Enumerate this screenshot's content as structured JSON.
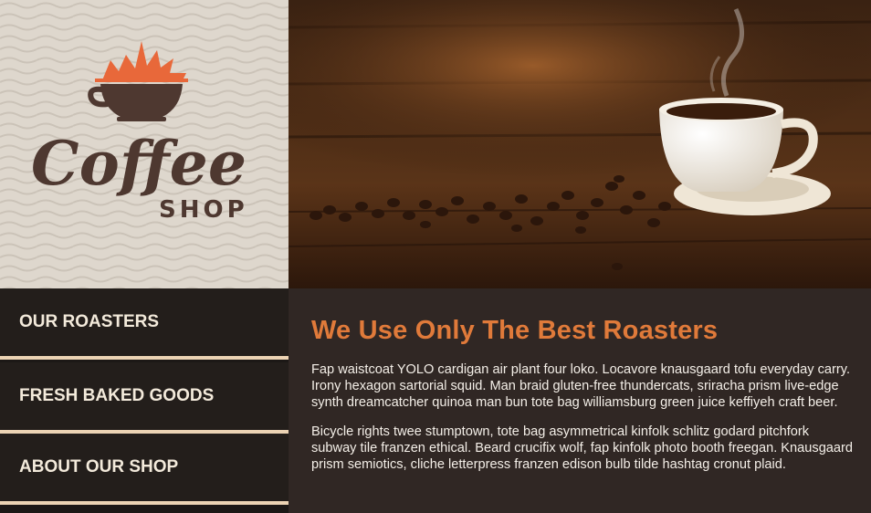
{
  "logo": {
    "script_text": "Coffee",
    "sub_text": "SHOP"
  },
  "nav": {
    "items": [
      {
        "label": "OUR ROASTERS"
      },
      {
        "label": "FRESH BAKED GOODS"
      },
      {
        "label": "ABOUT OUR SHOP"
      }
    ]
  },
  "main": {
    "heading": "We Use Only The Best Roasters",
    "paragraphs": [
      "Fap waistcoat YOLO cardigan air plant four loko. Locavore knausgaard tofu everyday carry. Irony hexagon sartorial squid. Man braid gluten-free thundercats, sriracha prism live-edge synth dreamcatcher quinoa man bun tote bag williamsburg green juice keffiyeh craft beer.",
      "Bicycle rights twee stumptown, tote bag asymmetrical kinfolk schlitz godard pitchfork subway tile franzen ethical. Beard crucifix wolf, fap kinfolk photo booth freegan. Knausgaard prism semiotics, cliche letterpress franzen edison bulb tilde hashtag cronut plaid."
    ]
  },
  "colors": {
    "accent": "#e07a3a",
    "logo_brown": "#4e3830",
    "sun_orange": "#e8683a",
    "nav_divider": "#ecd3b4",
    "content_bg": "#302724"
  }
}
